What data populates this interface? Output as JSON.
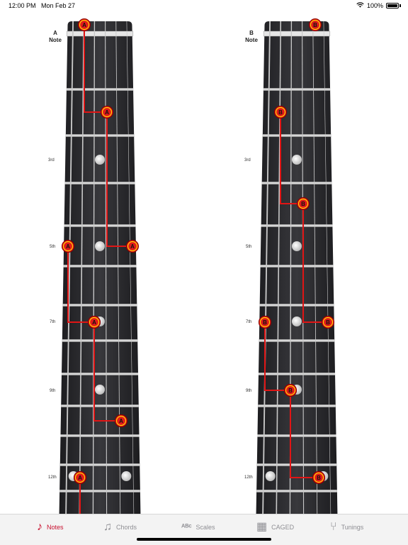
{
  "status": {
    "time": "12:00 PM",
    "date": "Mon Feb 27",
    "battery": "100%"
  },
  "necks": [
    {
      "title": "A",
      "subtitle": "Note",
      "labels": [
        "3rd",
        "5th",
        "7th",
        "9th",
        "12th"
      ],
      "marker_letter": "A",
      "markers_count": 7
    },
    {
      "title": "B",
      "subtitle": "Note",
      "labels": [
        "3rd",
        "5th",
        "7th",
        "9th",
        "12th"
      ],
      "marker_letter": "B",
      "markers_count": 7
    }
  ],
  "tabs": [
    {
      "label": "Notes",
      "icon": "music-note-icon",
      "active": true
    },
    {
      "label": "Chords",
      "icon": "chords-icon",
      "active": false
    },
    {
      "label": "Scales",
      "icon": "scales-icon",
      "active": false
    },
    {
      "label": "CAGED",
      "icon": "grid-icon",
      "active": false
    },
    {
      "label": "Tunings",
      "icon": "tuning-fork-icon",
      "active": false
    }
  ],
  "colors": {
    "accent": "#c8102e",
    "marker": "#e11b1b",
    "marker_ring": "#ffd100",
    "fretboard": "#2b2b2e"
  }
}
